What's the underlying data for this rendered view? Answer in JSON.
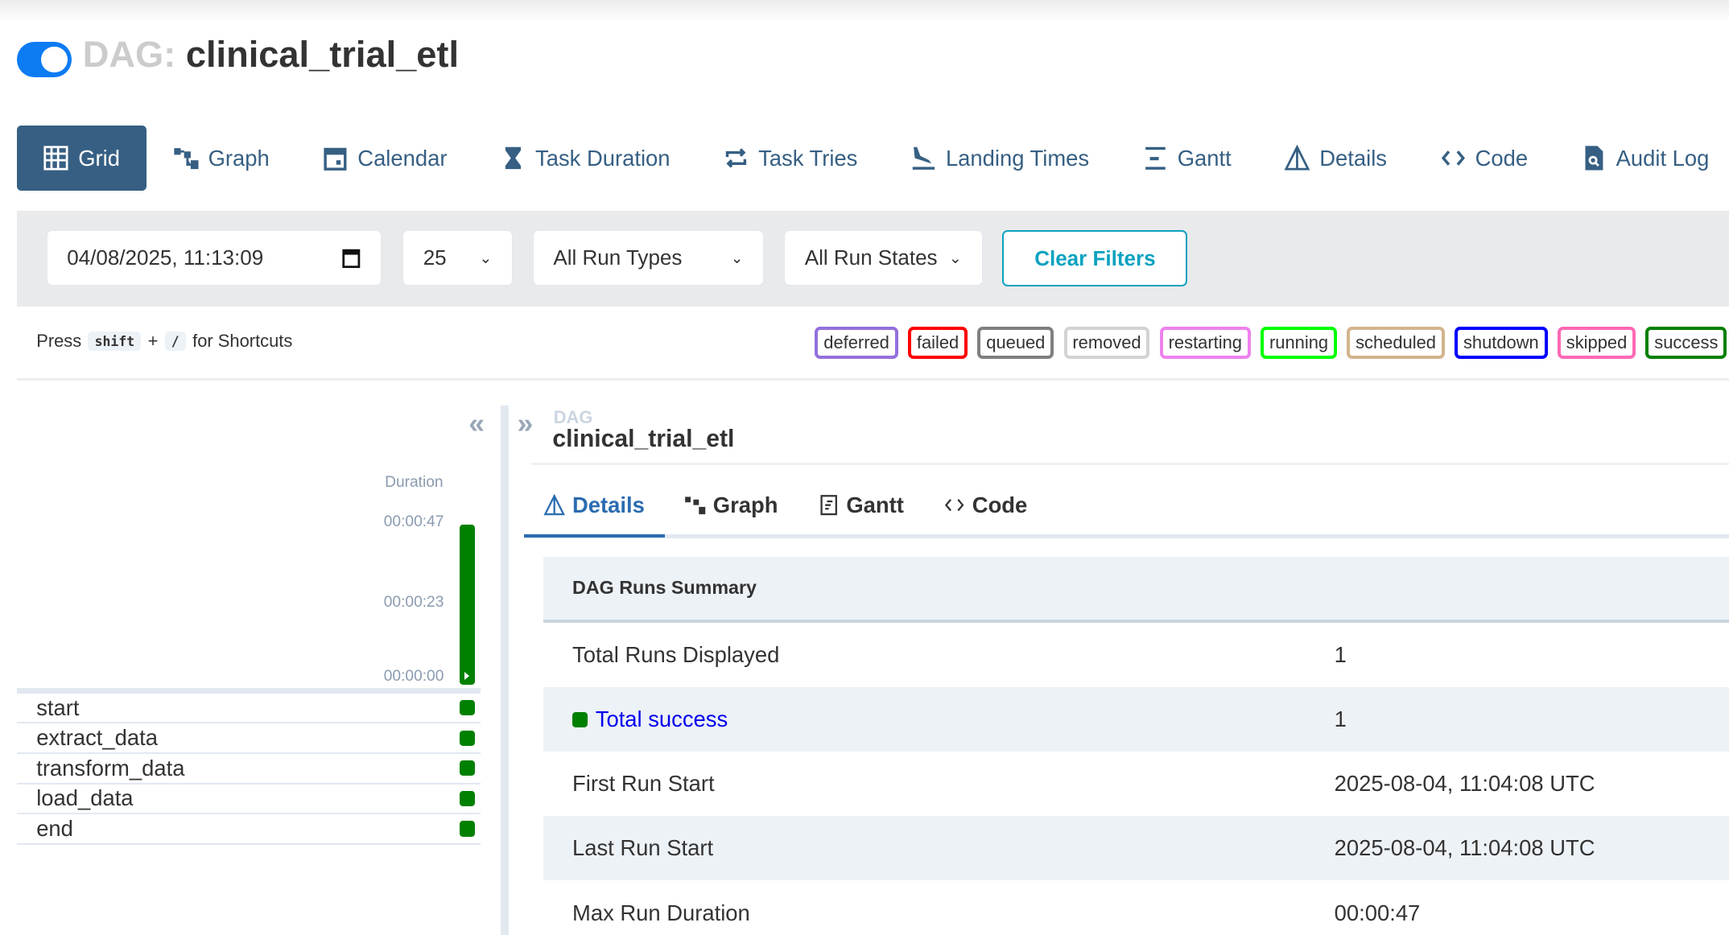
{
  "header": {
    "prefix": "DAG:",
    "dag_id": "clinical_trial_etl",
    "paused_toggle_on": true
  },
  "nav": [
    {
      "label": "Grid",
      "icon": "grid-icon",
      "active": true
    },
    {
      "label": "Graph",
      "icon": "graph-icon"
    },
    {
      "label": "Calendar",
      "icon": "calendar-icon"
    },
    {
      "label": "Task Duration",
      "icon": "hourglass-icon"
    },
    {
      "label": "Task Tries",
      "icon": "retry-icon"
    },
    {
      "label": "Landing Times",
      "icon": "plane-landing-icon"
    },
    {
      "label": "Gantt",
      "icon": "gantt-icon"
    },
    {
      "label": "Details",
      "icon": "details-triangle-icon"
    },
    {
      "label": "Code",
      "icon": "code-icon"
    },
    {
      "label": "Audit Log",
      "icon": "file-search-icon"
    }
  ],
  "filters": {
    "date": "04/08/2025, 11:13:09",
    "num_runs": "25",
    "run_type": "All Run Types",
    "run_state": "All Run States",
    "clear": "Clear Filters"
  },
  "shortcut": {
    "press": "Press",
    "key1": "shift",
    "plus": "+",
    "key2": "/",
    "suffix": "for Shortcuts"
  },
  "legend": [
    {
      "label": "deferred",
      "color": "#9370db"
    },
    {
      "label": "failed",
      "color": "#ff0000"
    },
    {
      "label": "queued",
      "color": "#808080"
    },
    {
      "label": "removed",
      "color": "#d3d3d3"
    },
    {
      "label": "restarting",
      "color": "#ee82ee"
    },
    {
      "label": "running",
      "color": "#00ff00"
    },
    {
      "label": "scheduled",
      "color": "#d2b48c"
    },
    {
      "label": "shutdown",
      "color": "#0000ff"
    },
    {
      "label": "skipped",
      "color": "#ff69b4"
    },
    {
      "label": "success",
      "color": "#008000"
    }
  ],
  "grid": {
    "duration_label": "Duration",
    "ticks": [
      "00:00:47",
      "00:00:23",
      "00:00:00"
    ],
    "run_duration_fraction": 1.0,
    "tasks": [
      "start",
      "extract_data",
      "transform_data",
      "load_data",
      "end"
    ],
    "task_state": "success"
  },
  "details": {
    "dag_label": "DAG",
    "dag_id": "clinical_trial_etl",
    "tabs": [
      {
        "label": "Details",
        "active": true
      },
      {
        "label": "Graph"
      },
      {
        "label": "Gantt"
      },
      {
        "label": "Code"
      }
    ],
    "summary_title": "DAG Runs Summary",
    "rows": [
      {
        "key": "Total Runs Displayed",
        "value": "1"
      },
      {
        "key": "Total success",
        "value": "1"
      },
      {
        "key": "First Run Start",
        "value": "2025-08-04, 11:04:08 UTC"
      },
      {
        "key": "Last Run Start",
        "value": "2025-08-04, 11:04:08 UTC"
      },
      {
        "key": "Max Run Duration",
        "value": "00:00:47"
      }
    ]
  }
}
